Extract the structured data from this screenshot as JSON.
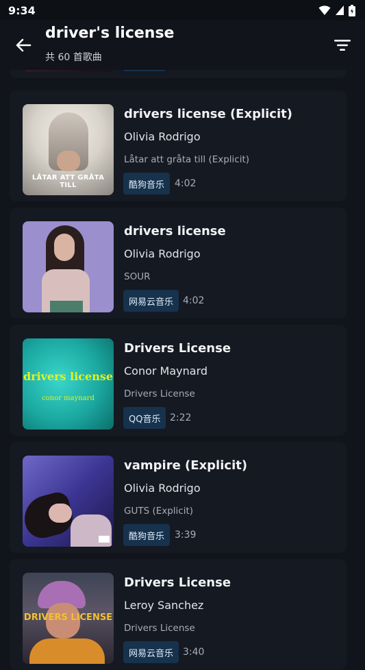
{
  "status": {
    "time": "9:34"
  },
  "header": {
    "title": "driver's license",
    "count_text": "共 60 首歌曲"
  },
  "songs": [
    {
      "title": "drivers license (Explicit)",
      "artist": "Olivia Rodrigo",
      "album": "Låtar att gråta till (Explicit)",
      "source": "酷狗音乐",
      "duration": "4:02",
      "cover_text": "LÅTAR ATT GRÅTA TILL"
    },
    {
      "title": "drivers license",
      "artist": "Olivia Rodrigo",
      "album": "SOUR",
      "source": "网易云音乐",
      "duration": "4:02"
    },
    {
      "title": "Drivers License",
      "artist": "Conor Maynard",
      "album": "Drivers License",
      "source": "QQ音乐",
      "duration": "2:22",
      "cover_text_1": "drivers license",
      "cover_text_2": "conor maynard"
    },
    {
      "title": "vampire (Explicit)",
      "artist": "Olivia Rodrigo",
      "album": "GUTS (Explicit)",
      "source": "酷狗音乐",
      "duration": "3:39"
    },
    {
      "title": "Drivers License",
      "artist": "Leroy Sanchez",
      "album": "Drivers License",
      "source": "网易云音乐",
      "duration": "3:40",
      "cover_text": "DRIVERS LICENSE"
    }
  ],
  "colors": {
    "background": "#11141a",
    "card": "#151922",
    "badge": "#16324d"
  }
}
